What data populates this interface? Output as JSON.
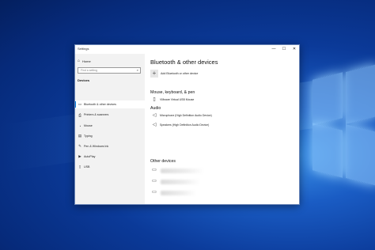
{
  "window": {
    "title": "Settings",
    "minimize": "—",
    "maximize": "☐",
    "close": "✕"
  },
  "sidebar": {
    "home": "Home",
    "search_placeholder": "Find a setting",
    "section": "Devices",
    "items": [
      {
        "label": "Bluetooth & other devices",
        "icon": "bluetooth-icon",
        "active": true
      },
      {
        "label": "Printers & scanners",
        "icon": "printer-icon"
      },
      {
        "label": "Mouse",
        "icon": "mouse-icon"
      },
      {
        "label": "Typing",
        "icon": "keyboard-icon"
      },
      {
        "label": "Pen & Windows Ink",
        "icon": "pen-icon"
      },
      {
        "label": "AutoPlay",
        "icon": "autoplay-icon"
      },
      {
        "label": "USB",
        "icon": "usb-icon"
      }
    ]
  },
  "content": {
    "title": "Bluetooth & other devices",
    "add_label": "Add Bluetooth or other device",
    "sections": {
      "mouse": "Mouse, keyboard, & pen",
      "audio": "Audio",
      "other": "Other devices"
    },
    "mouse_devices": [
      "VMware Virtual USB Mouse"
    ],
    "audio_devices": [
      "Microphone (High Definition Audio Device)",
      "Speakers (High Definition Audio Device)"
    ]
  }
}
